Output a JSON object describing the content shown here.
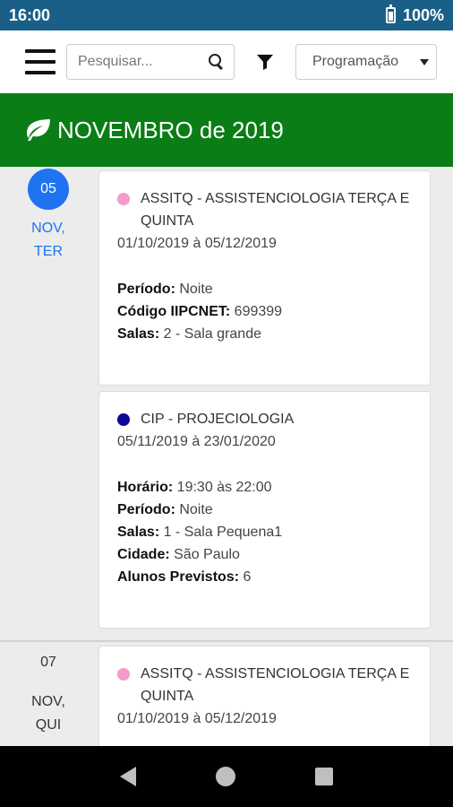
{
  "status_bar": {
    "time": "16:00",
    "battery": "100%"
  },
  "toolbar": {
    "search_placeholder": "Pesquisar...",
    "select_value": "Programação"
  },
  "month_header": {
    "title": "NOVEMBRO de 2019"
  },
  "days": [
    {
      "day": "05",
      "month_weekday": [
        "NOV,",
        "TER"
      ],
      "active": true,
      "events": [
        {
          "color": "#f59ac9",
          "title_line1": "ASSITQ - ASSISTENCIOLOGIA TERÇA E",
          "title_line2": "QUINTA",
          "date_range": "01/10/2019 à 05/12/2019",
          "fields": [
            {
              "label": "Período:",
              "value": " Noite"
            },
            {
              "label": "Código IIPCNET:",
              "value": " 699399"
            },
            {
              "label": "Salas:",
              "value": " 2 - Sala grande"
            }
          ]
        },
        {
          "color": "#0a0a96",
          "title_line1": "CIP - PROJECIOLOGIA",
          "date_range": "05/11/2019 à 23/01/2020",
          "fields": [
            {
              "label": "Horário:",
              "value": " 19:30 às 22:00"
            },
            {
              "label": "Período:",
              "value": " Noite"
            },
            {
              "label": "Salas:",
              "value": " 1 - Sala Pequena1"
            },
            {
              "label": "Cidade:",
              "value": " São Paulo"
            },
            {
              "label": "Alunos Previstos:",
              "value": " 6"
            }
          ]
        }
      ]
    },
    {
      "day": "07",
      "month_weekday": [
        "NOV,",
        "QUI"
      ],
      "active": false,
      "events": [
        {
          "color": "#f59ac9",
          "title_line1": "ASSITQ - ASSISTENCIOLOGIA TERÇA E",
          "title_line2": "QUINTA",
          "date_range": "01/10/2019 à 05/12/2019"
        }
      ]
    }
  ]
}
